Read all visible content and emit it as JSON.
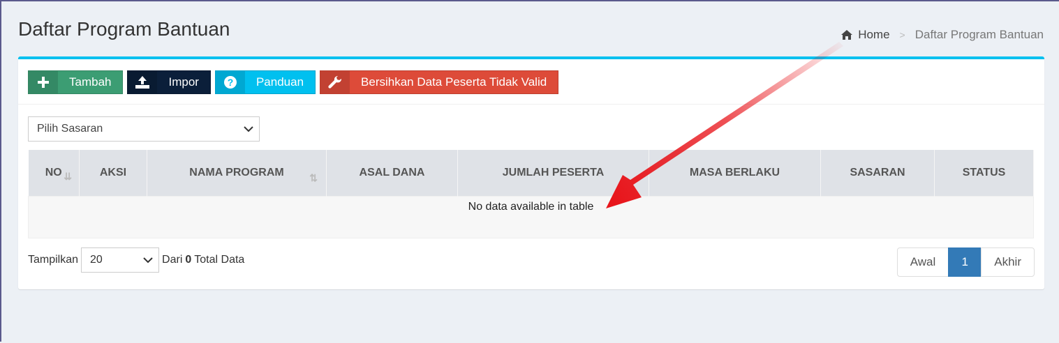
{
  "page": {
    "title": "Daftar Program Bantuan"
  },
  "breadcrumb": {
    "home": "Home",
    "separator": ">",
    "current": "Daftar Program Bantuan"
  },
  "toolbar": {
    "add_label": "Tambah",
    "import_label": "Impor",
    "guide_label": "Panduan",
    "clean_label": "Bersihkan Data Peserta Tidak Valid"
  },
  "filter": {
    "selected": "Pilih Sasaran"
  },
  "table": {
    "columns": [
      "NO",
      "AKSI",
      "NAMA PROGRAM",
      "ASAL DANA",
      "JUMLAH PESERTA",
      "MASA BERLAKU",
      "SASARAN",
      "STATUS"
    ],
    "empty_message": "No data available in table"
  },
  "footer": {
    "show_label": "Tampilkan",
    "page_size": "20",
    "of_label": "Dari",
    "total": "0",
    "total_label": "Total Data"
  },
  "pagination": {
    "first": "Awal",
    "current": "1",
    "last": "Akhir"
  },
  "colors": {
    "accent": "#00c0ef",
    "green": "#3c9d73",
    "navy": "#0b1f3a",
    "red": "#dd4b39",
    "primary": "#337ab7",
    "arrow": "#e8151b"
  }
}
